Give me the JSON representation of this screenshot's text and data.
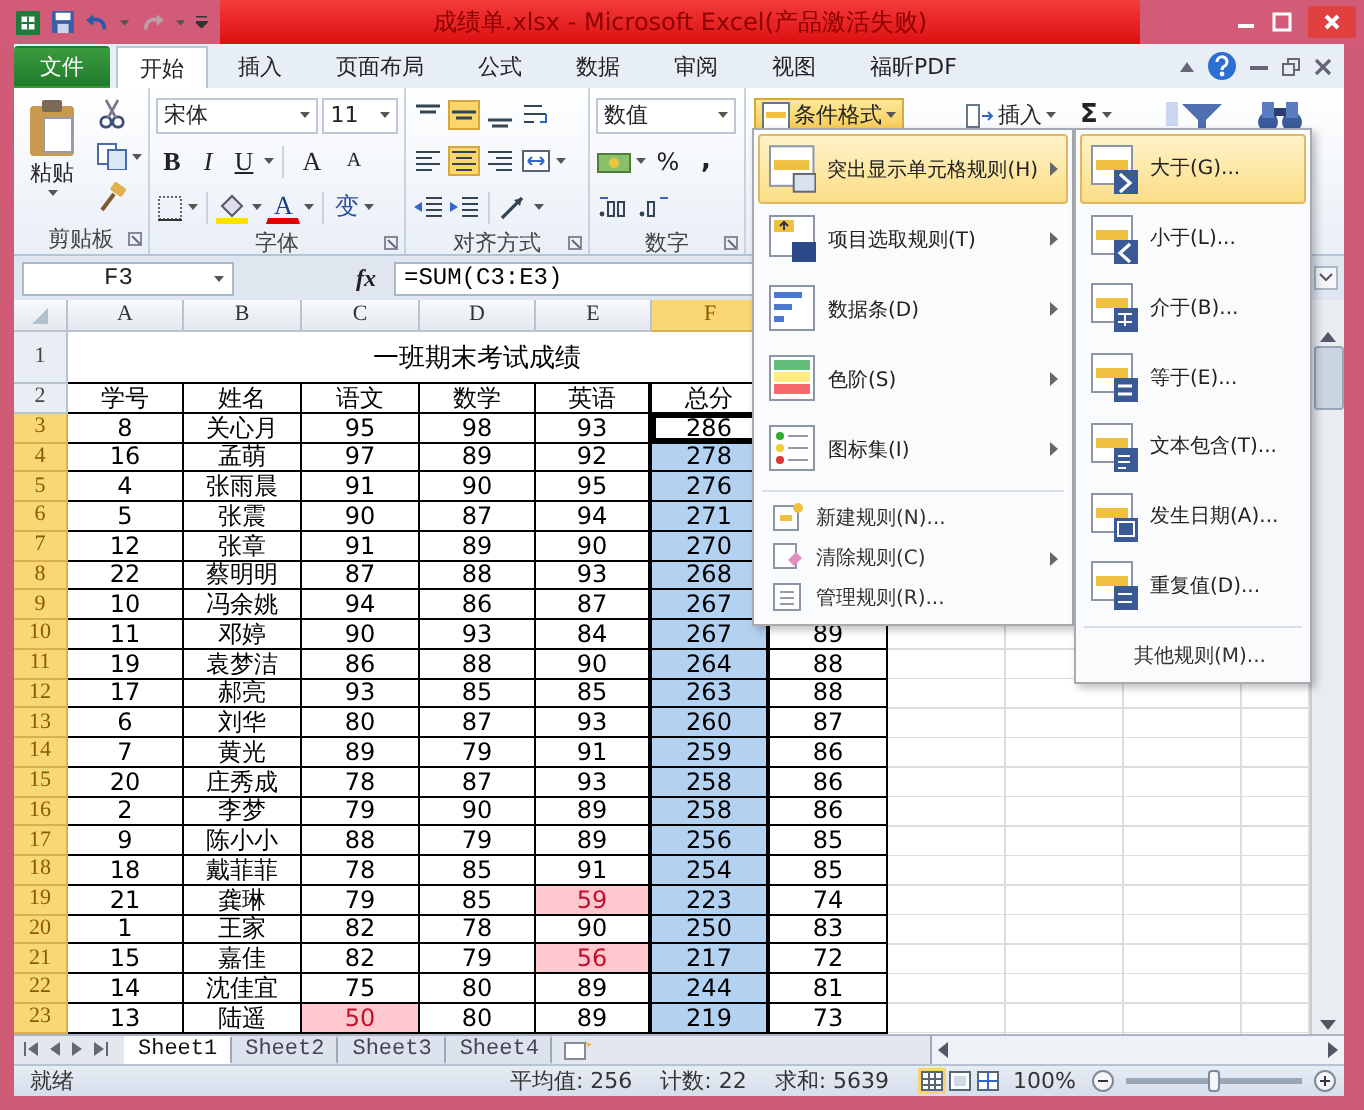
{
  "window": {
    "title": "成绩单.xlsx - Microsoft Excel(产品激活失败)"
  },
  "ribbon_tabs": [
    {
      "label": "文件",
      "kind": "file",
      "selected": false
    },
    {
      "label": "开始",
      "kind": "tab",
      "selected": true
    },
    {
      "label": "插入",
      "kind": "tab",
      "selected": false
    },
    {
      "label": "页面布局",
      "kind": "tab",
      "selected": false
    },
    {
      "label": "公式",
      "kind": "tab",
      "selected": false
    },
    {
      "label": "数据",
      "kind": "tab",
      "selected": false
    },
    {
      "label": "审阅",
      "kind": "tab",
      "selected": false
    },
    {
      "label": "视图",
      "kind": "tab",
      "selected": false
    },
    {
      "label": "福昕PDF",
      "kind": "tab",
      "selected": false
    }
  ],
  "ribbon": {
    "clipboard": {
      "label": "剪贴板",
      "paste": "粘贴"
    },
    "font": {
      "label": "字体",
      "font_name": "宋体",
      "font_size": "11",
      "bold": "B",
      "italic": "I",
      "underline": "U",
      "grow": "A",
      "shrink": "A",
      "font_color": "A",
      "phonetic": "变"
    },
    "alignment": {
      "label": "对齐方式",
      "buttons": [
        {
          "kind": "top",
          "selected": false
        },
        {
          "kind": "middle",
          "selected": true
        },
        {
          "kind": "bottom",
          "selected": false
        },
        {
          "kind": "wrap",
          "selected": false
        },
        {
          "kind": "left",
          "selected": false
        },
        {
          "kind": "center",
          "selected": true
        },
        {
          "kind": "right",
          "selected": false
        },
        {
          "kind": "merge",
          "selected": false
        }
      ]
    },
    "number": {
      "label": "数字",
      "format": "数值",
      "percent": "%",
      "comma": ","
    },
    "styles": {
      "conditional_format": "条件格式",
      "pressed": true
    },
    "cells": {
      "insert": "插入"
    },
    "editing": {
      "sum": "Σ"
    }
  },
  "formula_bar": {
    "name_box": "F3",
    "function_button": "fx",
    "formula": "=SUM(C3:E3)"
  },
  "sheet": {
    "columns": [
      {
        "label": "A",
        "selected": false
      },
      {
        "label": "B",
        "selected": false
      },
      {
        "label": "C",
        "selected": false
      },
      {
        "label": "D",
        "selected": false
      },
      {
        "label": "E",
        "selected": false
      },
      {
        "label": "F",
        "selected": true
      }
    ],
    "title_row": {
      "row": "1",
      "selected": false,
      "title": "一班期末考试成绩"
    },
    "header_row": {
      "row": "2",
      "selected": false,
      "cells": [
        "学号",
        "姓名",
        "语文",
        "数学",
        "英语",
        "总分"
      ]
    },
    "rows": [
      {
        "row": "3",
        "selected": true,
        "active": true,
        "cells": [
          "8",
          "关心月",
          "95",
          "98",
          "93",
          "286"
        ],
        "flagged": [
          false,
          false,
          false,
          false,
          false,
          false
        ]
      },
      {
        "row": "4",
        "selected": true,
        "active": false,
        "cells": [
          "16",
          "孟萌",
          "97",
          "89",
          "92",
          "278"
        ],
        "flagged": [
          false,
          false,
          false,
          false,
          false,
          false
        ]
      },
      {
        "row": "5",
        "selected": true,
        "active": false,
        "cells": [
          "4",
          "张雨晨",
          "91",
          "90",
          "95",
          "276"
        ],
        "flagged": [
          false,
          false,
          false,
          false,
          false,
          false
        ]
      },
      {
        "row": "6",
        "selected": true,
        "active": false,
        "cells": [
          "5",
          "张震",
          "90",
          "87",
          "94",
          "271"
        ],
        "flagged": [
          false,
          false,
          false,
          false,
          false,
          false
        ]
      },
      {
        "row": "7",
        "selected": true,
        "active": false,
        "cells": [
          "12",
          "张章",
          "91",
          "89",
          "90",
          "270"
        ],
        "flagged": [
          false,
          false,
          false,
          false,
          false,
          false
        ]
      },
      {
        "row": "8",
        "selected": true,
        "active": false,
        "cells": [
          "22",
          "蔡明明",
          "87",
          "88",
          "93",
          "268"
        ],
        "flagged": [
          false,
          false,
          false,
          false,
          false,
          false
        ]
      },
      {
        "row": "9",
        "selected": true,
        "active": false,
        "cells": [
          "10",
          "冯余姚",
          "94",
          "86",
          "87",
          "267"
        ],
        "flagged": [
          false,
          false,
          false,
          false,
          false,
          false
        ]
      },
      {
        "row": "10",
        "selected": true,
        "active": false,
        "cells": [
          "11",
          "邓婷",
          "90",
          "93",
          "84",
          "267",
          "89"
        ],
        "flagged": [
          false,
          false,
          false,
          false,
          false,
          false,
          false
        ]
      },
      {
        "row": "11",
        "selected": true,
        "active": false,
        "cells": [
          "19",
          "袁梦洁",
          "86",
          "88",
          "90",
          "264",
          "88"
        ],
        "flagged": [
          false,
          false,
          false,
          false,
          false,
          false,
          false
        ]
      },
      {
        "row": "12",
        "selected": true,
        "active": false,
        "cells": [
          "17",
          "郝亮",
          "93",
          "85",
          "85",
          "263",
          "88"
        ],
        "flagged": [
          false,
          false,
          false,
          false,
          false,
          false,
          false
        ]
      },
      {
        "row": "13",
        "selected": true,
        "active": false,
        "cells": [
          "6",
          "刘华",
          "80",
          "87",
          "93",
          "260",
          "87"
        ],
        "flagged": [
          false,
          false,
          false,
          false,
          false,
          false,
          false
        ]
      },
      {
        "row": "14",
        "selected": true,
        "active": false,
        "cells": [
          "7",
          "黄光",
          "89",
          "79",
          "91",
          "259",
          "86"
        ],
        "flagged": [
          false,
          false,
          false,
          false,
          false,
          false,
          false
        ]
      },
      {
        "row": "15",
        "selected": true,
        "active": false,
        "cells": [
          "20",
          "庄秀成",
          "78",
          "87",
          "93",
          "258",
          "86"
        ],
        "flagged": [
          false,
          false,
          false,
          false,
          false,
          false,
          false
        ]
      },
      {
        "row": "16",
        "selected": true,
        "active": false,
        "cells": [
          "2",
          "李梦",
          "79",
          "90",
          "89",
          "258",
          "86"
        ],
        "flagged": [
          false,
          false,
          false,
          false,
          false,
          false,
          false
        ]
      },
      {
        "row": "17",
        "selected": true,
        "active": false,
        "cells": [
          "9",
          "陈小小",
          "88",
          "79",
          "89",
          "256",
          "85"
        ],
        "flagged": [
          false,
          false,
          false,
          false,
          false,
          false,
          false
        ]
      },
      {
        "row": "18",
        "selected": true,
        "active": false,
        "cells": [
          "18",
          "戴菲菲",
          "78",
          "85",
          "91",
          "254",
          "85"
        ],
        "flagged": [
          false,
          false,
          false,
          false,
          false,
          false,
          false
        ]
      },
      {
        "row": "19",
        "selected": true,
        "active": false,
        "cells": [
          "21",
          "龚琳",
          "79",
          "85",
          "59",
          "223",
          "74"
        ],
        "flagged": [
          false,
          false,
          false,
          false,
          true,
          false,
          false
        ]
      },
      {
        "row": "20",
        "selected": true,
        "active": false,
        "cells": [
          "1",
          "王家",
          "82",
          "78",
          "90",
          "250",
          "83"
        ],
        "flagged": [
          false,
          false,
          false,
          false,
          false,
          false,
          false
        ]
      },
      {
        "row": "21",
        "selected": true,
        "active": false,
        "cells": [
          "15",
          "嘉佳",
          "82",
          "79",
          "56",
          "217",
          "72"
        ],
        "flagged": [
          false,
          false,
          false,
          false,
          true,
          false,
          false
        ]
      },
      {
        "row": "22",
        "selected": true,
        "active": false,
        "cells": [
          "14",
          "沈佳宜",
          "75",
          "80",
          "89",
          "244",
          "81"
        ],
        "flagged": [
          false,
          false,
          false,
          false,
          false,
          false,
          false
        ]
      },
      {
        "row": "23",
        "selected": true,
        "active": false,
        "cells": [
          "13",
          "陆遥",
          "50",
          "80",
          "89",
          "219",
          "73"
        ],
        "flagged": [
          false,
          false,
          true,
          false,
          false,
          false,
          false
        ]
      }
    ]
  },
  "conditional_format_menu": {
    "items": [
      {
        "label": "突出显示单元格规则(H)",
        "kind": "large",
        "has_submenu": true,
        "selected": true
      },
      {
        "label": "项目选取规则(T)",
        "kind": "large",
        "has_submenu": true,
        "selected": false
      },
      {
        "label": "数据条(D)",
        "kind": "large",
        "has_submenu": true,
        "selected": false
      },
      {
        "label": "色阶(S)",
        "kind": "large",
        "has_submenu": true,
        "selected": false
      },
      {
        "label": "图标集(I)",
        "kind": "large",
        "has_submenu": true,
        "selected": false
      },
      {
        "label": "新建规则(N)...",
        "kind": "small",
        "has_submenu": false,
        "selected": false
      },
      {
        "label": "清除规则(C)",
        "kind": "small",
        "has_submenu": true,
        "selected": false
      },
      {
        "label": "管理规则(R)...",
        "kind": "small",
        "has_submenu": false,
        "selected": false
      }
    ]
  },
  "highlight_rules_submenu": {
    "items": [
      {
        "label": "大于(G)...",
        "kind": "large",
        "selected": true
      },
      {
        "label": "小于(L)...",
        "kind": "large",
        "selected": false
      },
      {
        "label": "介于(B)...",
        "kind": "large",
        "selected": false
      },
      {
        "label": "等于(E)...",
        "kind": "large",
        "selected": false
      },
      {
        "label": "文本包含(T)...",
        "kind": "large",
        "selected": false
      },
      {
        "label": "发生日期(A)...",
        "kind": "large",
        "selected": false
      },
      {
        "label": "重复值(D)...",
        "kind": "large",
        "selected": false
      },
      {
        "label": "其他规则(M)...",
        "kind": "plain",
        "selected": false
      }
    ]
  },
  "sheet_tabs": [
    {
      "label": "Sheet1",
      "selected": true
    },
    {
      "label": "Sheet2",
      "selected": false
    },
    {
      "label": "Sheet3",
      "selected": false
    },
    {
      "label": "Sheet4",
      "selected": false
    }
  ],
  "status_bar": {
    "mode": "就绪",
    "average": "平均值: 256",
    "count": "计数: 22",
    "sum": "求和: 5639",
    "views": [
      {
        "kind": "normal",
        "selected": true
      },
      {
        "kind": "page_layout",
        "selected": false
      },
      {
        "kind": "page_break",
        "selected": false
      }
    ],
    "zoom": "100%",
    "zoom_slider": {
      "level": 0.5
    }
  }
}
